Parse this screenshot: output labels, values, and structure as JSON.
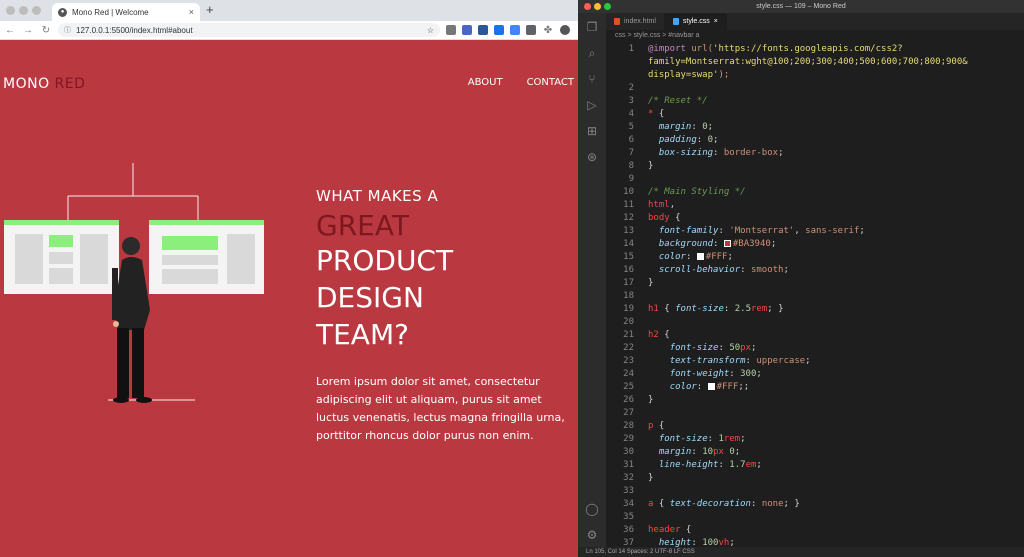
{
  "browser": {
    "tab_title": "Mono Red | Welcome",
    "tab_close": "×",
    "new_tab": "+",
    "url": "127.0.0.1:5500/index.html#about",
    "page": {
      "logo_main": "MONO",
      "logo_accent": "RED",
      "nav": [
        "ABOUT",
        "CONTACT"
      ],
      "heading_small": "WHAT MAKES A",
      "heading_accent": "GREAT",
      "heading_lines": [
        "PRODUCT",
        "DESIGN",
        "TEAM?"
      ],
      "paragraph": "Lorem ipsum dolor sit amet, consectetur adipiscing elit ut aliquam, purus sit amet luctus venenatis, lectus magna fringilla urna, porttitor rhoncus dolor purus non enim."
    }
  },
  "vscode": {
    "title": "style.css — 109 – Mono Red",
    "tabs": [
      "index.html",
      "style.css"
    ],
    "breadcrumb": "css  >  style.css  >  #navbar a",
    "colors": {
      "bg": "#BA3940",
      "text": "#FFF"
    },
    "status": "Ln 105, Col 14   Spaces: 2   UTF-8   LF   CSS"
  }
}
